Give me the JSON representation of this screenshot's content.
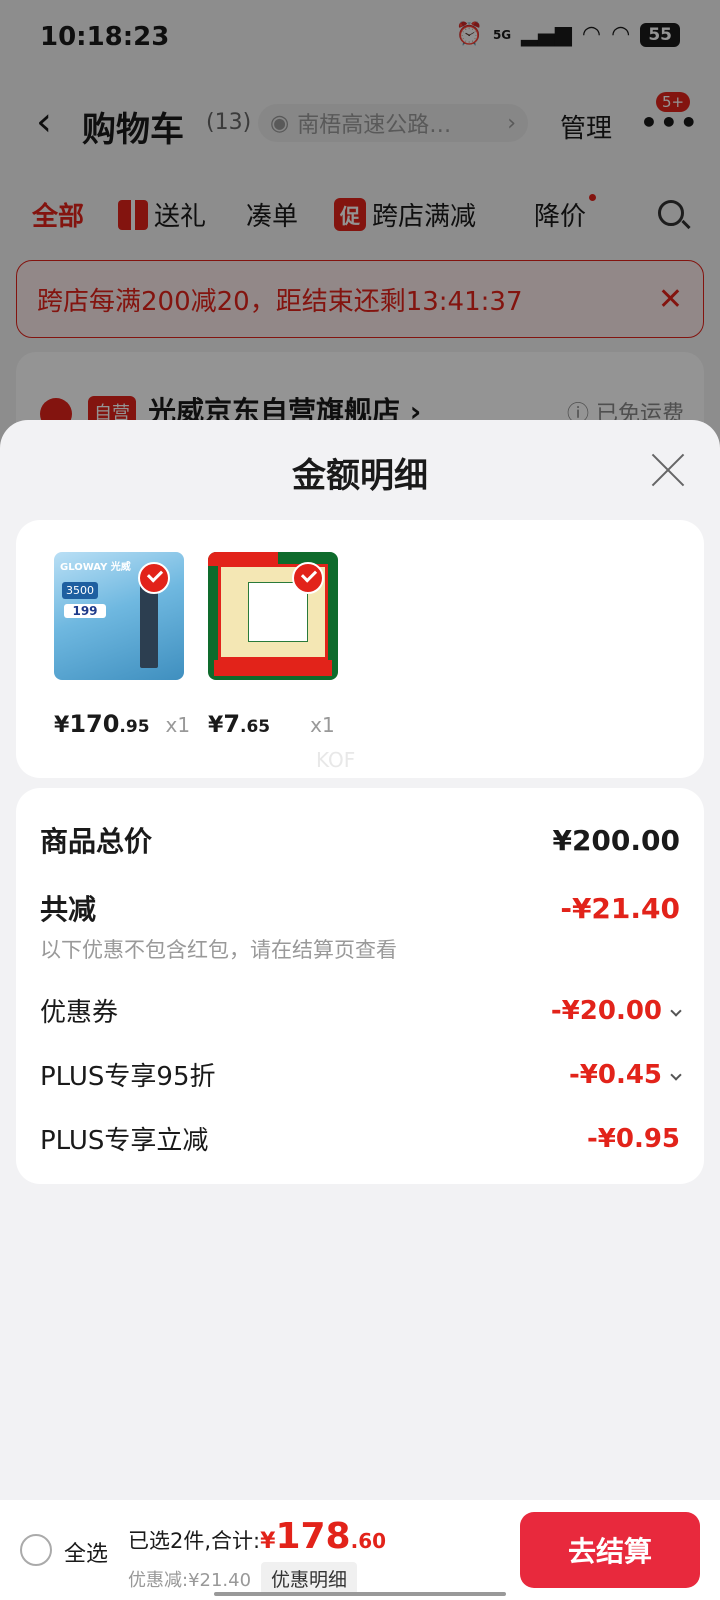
{
  "status_bar": {
    "time": "10:18:23",
    "network": "5G",
    "battery": "55"
  },
  "cart_header": {
    "title": "购物车",
    "count": "(13)",
    "address": "南梧高速公路…",
    "manage_label": "管理",
    "more_badge": "5+"
  },
  "filters": {
    "all": "全部",
    "gift": "送礼",
    "combine": "凑单",
    "promo_tag": "促",
    "cross_shop": "跨店满减",
    "price_drop": "降价"
  },
  "promo_banner": {
    "text": "跨店每满200减20，距结束还剩13:41:37"
  },
  "shop": {
    "tag": "自营",
    "name": "光威京东自营旗舰店 ›",
    "shipping": "ⓘ 已免运费"
  },
  "sheet": {
    "title": "金额明细",
    "products": [
      {
        "yen": "¥",
        "price_int": "170",
        "price_dec": ".95",
        "qty": "x1",
        "image_brand": "GLOWAY 光威",
        "image_capacity": "3500",
        "image_price": "199"
      },
      {
        "yen": "¥",
        "price_int": "7",
        "price_dec": ".65",
        "qty": "x1"
      }
    ],
    "watermark": "KOF",
    "details": {
      "total_label": "商品总价",
      "total_value": "¥200.00",
      "reduce_label": "共减",
      "reduce_value": "-¥21.40",
      "reduce_note": "以下优惠不包含红包，请在结算页查看",
      "coupon_label": "优惠券",
      "coupon_value": "-¥20.00",
      "plus95_label": "PLUS专享95折",
      "plus95_value": "-¥0.45",
      "plus_instant_label": "PLUS专享立减",
      "plus_instant_value": "-¥0.95"
    }
  },
  "bottom_bar": {
    "select_all": "全选",
    "summary": "已选2件,合计:",
    "total_yen": "¥",
    "total_int": "178",
    "total_dec": ".60",
    "discount": "优惠减:¥21.40",
    "detail_button": "优惠明细",
    "checkout": "去结算"
  },
  "colors": {
    "accent": "#e2231a",
    "checkout": "#e8293d"
  }
}
